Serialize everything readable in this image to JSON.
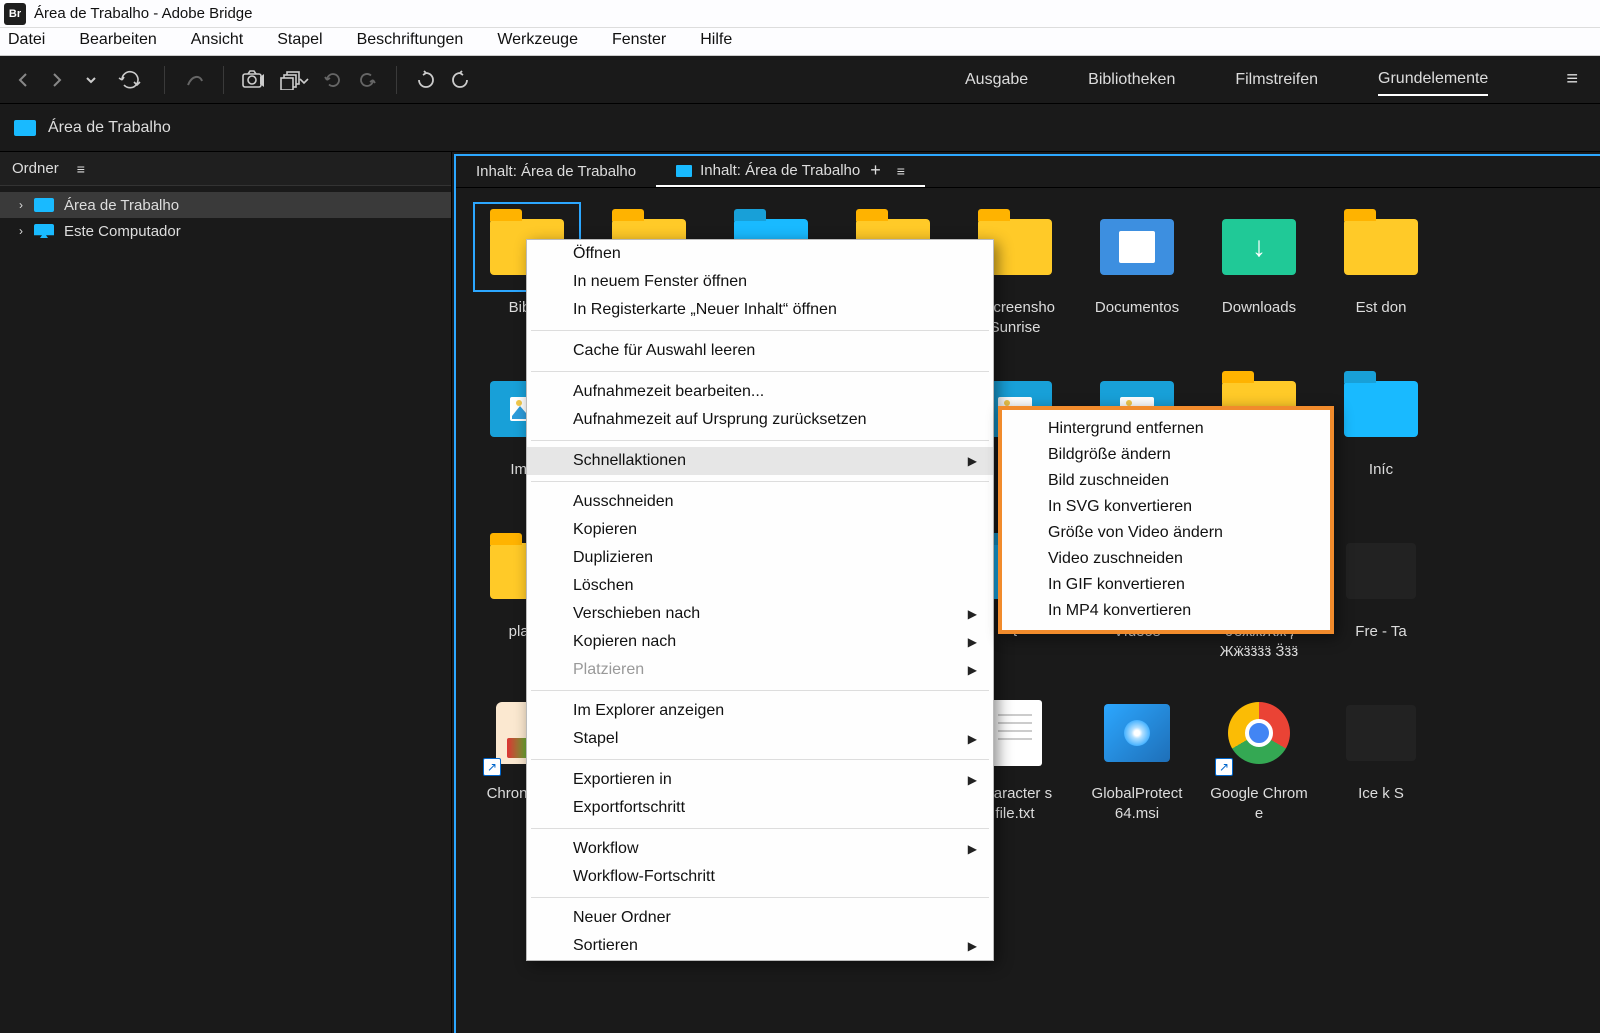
{
  "titlebar": {
    "app": "Br",
    "text": "Área de Trabalho - Adobe Bridge"
  },
  "menubar": [
    "Datei",
    "Bearbeiten",
    "Ansicht",
    "Stapel",
    "Beschriftungen",
    "Werkzeuge",
    "Fenster",
    "Hilfe"
  ],
  "workspaces": {
    "items": [
      "Ausgabe",
      "Bibliotheken",
      "Filmstreifen",
      "Grundelemente"
    ],
    "active": 3
  },
  "path": "Área de Trabalho",
  "sidebar": {
    "title": "Ordner",
    "tree": [
      {
        "label": "Área de Trabalho",
        "icon": "folder",
        "sel": true
      },
      {
        "label": "Este Computador",
        "icon": "pc",
        "sel": false
      }
    ]
  },
  "tabs": [
    {
      "label": "Inhalt: Área de Trabalho",
      "active": false,
      "chip": false
    },
    {
      "label": "Inhalt: Área de Trabalho",
      "active": true,
      "chip": true,
      "plus": "+"
    }
  ],
  "items": [
    {
      "label": "Biblio",
      "type": "fy",
      "sel": true
    },
    {
      "label": "",
      "type": "fy"
    },
    {
      "label": "",
      "type": "fb"
    },
    {
      "label": "",
      "type": "fy"
    },
    {
      "label": "_Screensho Sunrise",
      "type": "fy"
    },
    {
      "label": "Documentos",
      "type": "doc"
    },
    {
      "label": "Downloads",
      "type": "dn"
    },
    {
      "label": "Est don",
      "type": "fy"
    },
    {
      "label": "Imag",
      "type": "img"
    },
    {
      "label": "",
      "type": "img"
    },
    {
      "label": "",
      "type": "img"
    },
    {
      "label": "",
      "type": "img"
    },
    {
      "label": "",
      "type": "img"
    },
    {
      "label": "",
      "type": "img"
    },
    {
      "label": "",
      "type": "fy"
    },
    {
      "label": "Iníc",
      "type": "fb"
    },
    {
      "label": "platfo",
      "type": "fy"
    },
    {
      "label": "",
      "type": "fy"
    },
    {
      "label": "",
      "type": "fy"
    },
    {
      "label": "",
      "type": "fy"
    },
    {
      "label": "t",
      "type": "fb"
    },
    {
      "label": "Vídeos",
      "type": "img"
    },
    {
      "label": "€ҽӝӝӁӝӌ Жӝӟӟӟӟ Ӟӟӟ",
      "type": "fy"
    },
    {
      "label": "Fre - Ta",
      "type": "blank"
    },
    {
      "label": "Chron te De",
      "type": "ps",
      "shortcut": true
    },
    {
      "label": "",
      "type": "blank"
    },
    {
      "label": "",
      "type": "blank"
    },
    {
      "label": "",
      "type": "blank"
    },
    {
      "label": "character s file.txt",
      "type": "txt"
    },
    {
      "label": "GlobalProtect 64.msi",
      "type": "msi"
    },
    {
      "label": "Google Chrom e",
      "type": "chrome",
      "shortcut": true
    },
    {
      "label": "Ice k S",
      "type": "blank"
    }
  ],
  "ctx": {
    "groups": [
      [
        "Öffnen",
        "In neuem Fenster öffnen",
        "In Registerkarte „Neuer Inhalt“ öffnen"
      ],
      [
        "Cache für Auswahl leeren"
      ],
      [
        "Aufnahmezeit bearbeiten...",
        "Aufnahmezeit auf Ursprung zurücksetzen"
      ],
      [
        {
          "t": "Schnellaktionen",
          "arrow": true,
          "hl": true
        }
      ],
      [
        "Ausschneiden",
        "Kopieren",
        "Duplizieren",
        "Löschen",
        {
          "t": "Verschieben nach",
          "arrow": true
        },
        {
          "t": "Kopieren nach",
          "arrow": true
        },
        {
          "t": "Platzieren",
          "arrow": true,
          "dis": true
        }
      ],
      [
        "Im Explorer anzeigen",
        {
          "t": "Stapel",
          "arrow": true
        }
      ],
      [
        {
          "t": "Exportieren in",
          "arrow": true
        },
        "Exportfortschritt"
      ],
      [
        {
          "t": "Workflow",
          "arrow": true
        },
        "Workflow-Fortschritt"
      ],
      [
        "Neuer Ordner",
        {
          "t": "Sortieren",
          "arrow": true
        }
      ]
    ],
    "sub": [
      "Hintergrund entfernen",
      "Bildgröße ändern",
      "Bild zuschneiden",
      "In SVG konvertieren",
      "Größe von Video ändern",
      "Video zuschneiden",
      "In GIF konvertieren",
      "In MP4 konvertieren"
    ]
  }
}
